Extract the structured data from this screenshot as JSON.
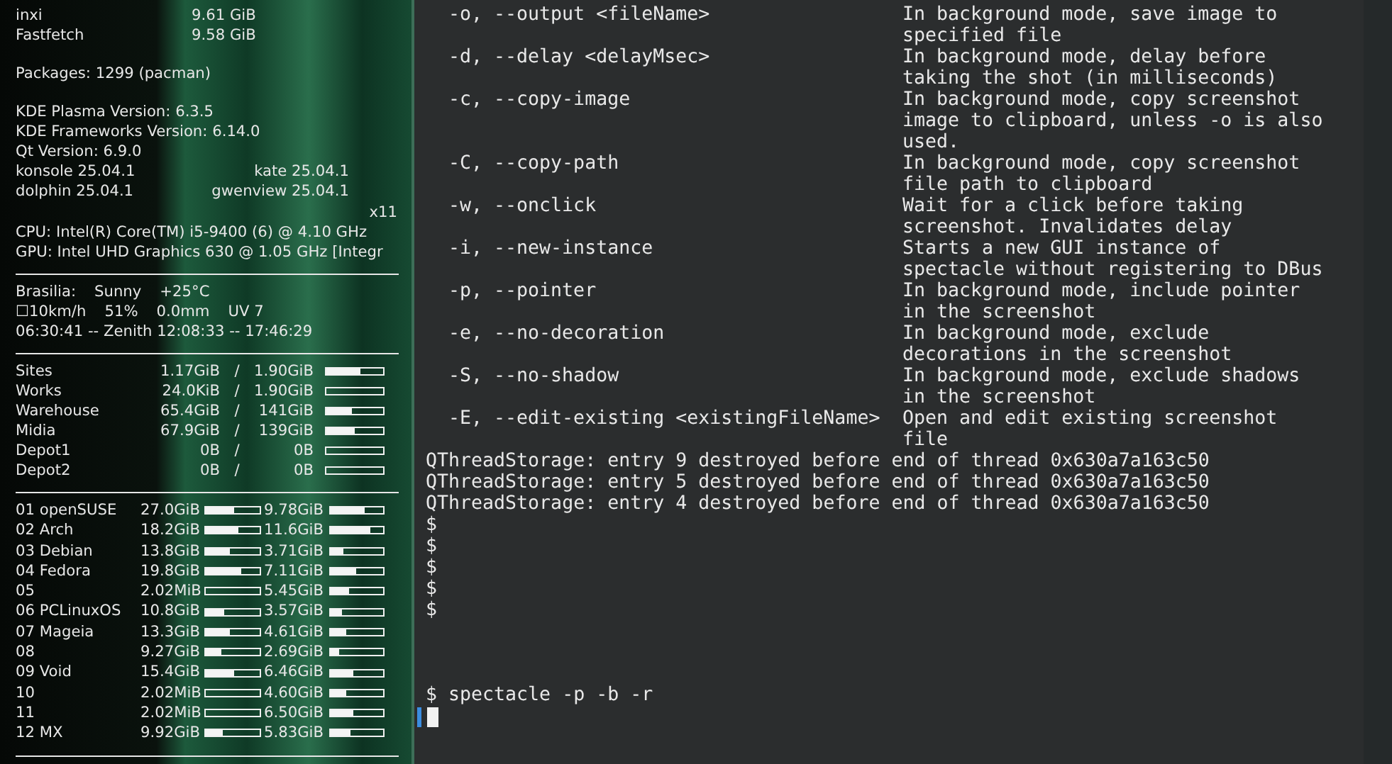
{
  "conky": {
    "memory": [
      {
        "name": "inxi",
        "value": "9.61 GiB"
      },
      {
        "name": "Fastfetch",
        "value": "9.58 GiB"
      }
    ],
    "packages": "Packages: 1299 (pacman)",
    "versions": [
      "KDE Plasma Version: 6.3.5",
      "KDE Frameworks Version: 6.14.0",
      "Qt Version: 6.9.0"
    ],
    "apps": [
      {
        "left": "konsole 25.04.1",
        "right": "kate 25.04.1"
      },
      {
        "left": "dolphin 25.04.1",
        "right": "gwenview 25.04.1"
      }
    ],
    "session": "x11",
    "cpu": "CPU: Intel(R) Core(TM) i5-9400 (6) @ 4.10 GHz",
    "gpu": "GPU: Intel UHD Graphics 630 @ 1.05 GHz [Integr",
    "weather": [
      [
        "Brasilia:",
        "Sunny",
        "+25°C"
      ],
      [
        "☐10km/h",
        "51%",
        "0.0mm",
        "UV 7"
      ],
      [
        "06:30:41 -- Zenith 12:08:33 -- 17:46:29"
      ]
    ],
    "disks": [
      {
        "name": "Sites",
        "used": "1.17GiB",
        "total": "1.90GiB",
        "level": 0.6
      },
      {
        "name": "Works",
        "used": "24.0KiB",
        "total": "1.90GiB",
        "level": 0
      },
      {
        "name": "Warehouse",
        "used": "65.4GiB",
        "total": "141GiB",
        "level": 0.46
      },
      {
        "name": "Midia",
        "used": "67.9GiB",
        "total": "139GiB",
        "level": 0.49
      },
      {
        "name": "Depot1",
        "used": "0B",
        "total": "0B",
        "level": 0
      },
      {
        "name": "Depot2",
        "used": "0B",
        "total": "0B",
        "level": 0
      }
    ],
    "separator": "/",
    "distros": [
      {
        "name": "01 openSUSE",
        "used": {
          "text": "27.0GiB",
          "level": 0.52
        },
        "free": {
          "text": "9.78GiB",
          "level": 0.64
        }
      },
      {
        "name": "02 Arch",
        "used": {
          "text": "18.2GiB",
          "level": 0.6
        },
        "free": {
          "text": "11.6GiB",
          "level": 0.77
        }
      },
      {
        "name": "03 Debian",
        "used": {
          "text": "13.8GiB",
          "level": 0.44
        },
        "free": {
          "text": "3.71GiB",
          "level": 0.25
        }
      },
      {
        "name": "04 Fedora",
        "used": {
          "text": "19.8GiB",
          "level": 0.67
        },
        "free": {
          "text": "7.11GiB",
          "level": 0.48
        }
      },
      {
        "name": "05",
        "used": {
          "text": "2.02MiB",
          "level": 0
        },
        "free": {
          "text": "5.45GiB",
          "level": 0.35
        }
      },
      {
        "name": "06 PCLinuxOS",
        "used": {
          "text": "10.8GiB",
          "level": 0.35
        },
        "free": {
          "text": "3.57GiB",
          "level": 0.22
        }
      },
      {
        "name": "07 Mageia",
        "used": {
          "text": "13.3GiB",
          "level": 0.44
        },
        "free": {
          "text": "4.61GiB",
          "level": 0.29
        }
      },
      {
        "name": "08",
        "used": {
          "text": "9.27GiB",
          "level": 0.29
        },
        "free": {
          "text": "2.69GiB",
          "level": 0.17
        }
      },
      {
        "name": "09 Void",
        "used": {
          "text": "15.4GiB",
          "level": 0.52
        },
        "free": {
          "text": "6.46GiB",
          "level": 0.42
        }
      },
      {
        "name": "10",
        "used": {
          "text": "2.02MiB",
          "level": 0
        },
        "free": {
          "text": "4.60GiB",
          "level": 0.29
        }
      },
      {
        "name": "11",
        "used": {
          "text": "2.02MiB",
          "level": 0
        },
        "free": {
          "text": "6.50GiB",
          "level": 0.42
        }
      },
      {
        "name": "12 MX",
        "used": {
          "text": "9.92GiB",
          "level": 0.32
        },
        "free": {
          "text": "5.83GiB",
          "level": 0.37
        }
      }
    ]
  },
  "terminal": {
    "options": [
      {
        "flag": "-o, --output <fileName>",
        "description": [
          "In background mode, save image to",
          "specified file"
        ]
      },
      {
        "flag": "-d, --delay <delayMsec>",
        "description": [
          "In background mode, delay before",
          "taking the shot (in milliseconds)"
        ]
      },
      {
        "flag": "-c, --copy-image",
        "description": [
          "In background mode, copy screenshot",
          "image to clipboard, unless -o is also",
          "used."
        ]
      },
      {
        "flag": "-C, --copy-path",
        "description": [
          "In background mode, copy screenshot",
          "file path to clipboard"
        ]
      },
      {
        "flag": "-w, --onclick",
        "description": [
          "Wait for a click before taking",
          "screenshot. Invalidates delay"
        ]
      },
      {
        "flag": "-i, --new-instance",
        "description": [
          "Starts a new GUI instance of",
          "spectacle without registering to DBus"
        ]
      },
      {
        "flag": "-p, --pointer",
        "description": [
          "In background mode, include pointer",
          "in the screenshot"
        ]
      },
      {
        "flag": "-e, --no-decoration",
        "description": [
          "In background mode, exclude",
          "decorations in the screenshot"
        ]
      },
      {
        "flag": "-S, --no-shadow",
        "description": [
          "In background mode, exclude shadows",
          "in the screenshot"
        ]
      },
      {
        "flag": "-E, --edit-existing <existingFileName>",
        "description": [
          "Open and edit existing screenshot",
          "file"
        ]
      }
    ],
    "messages": [
      "QThreadStorage: entry 9 destroyed before end of thread 0x630a7a163c50",
      "QThreadStorage: entry 5 destroyed before end of thread 0x630a7a163c50",
      "QThreadStorage: entry 4 destroyed before end of thread 0x630a7a163c50"
    ],
    "prompts": [
      "$",
      "$",
      "$",
      "$",
      "$"
    ],
    "command": "$ spectacle -p -b -r"
  }
}
